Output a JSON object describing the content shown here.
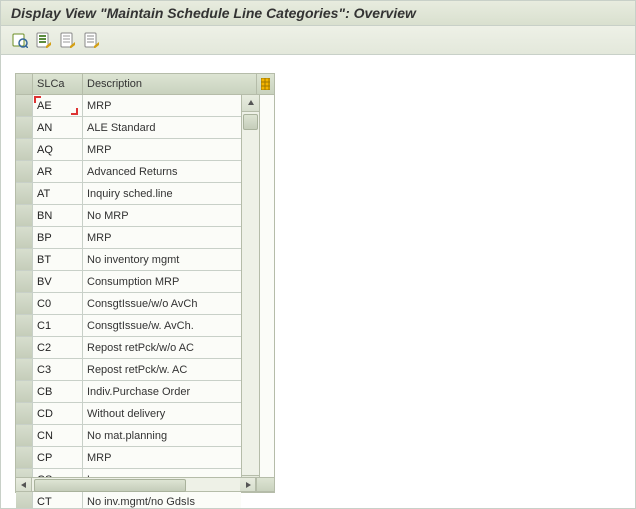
{
  "title": "Display View \"Maintain Schedule Line Categories\": Overview",
  "columns": {
    "slca": "SLCa",
    "desc": "Description"
  },
  "rows": [
    {
      "slca": "AE",
      "desc": "MRP"
    },
    {
      "slca": "AN",
      "desc": "ALE Standard"
    },
    {
      "slca": "AQ",
      "desc": "MRP"
    },
    {
      "slca": "AR",
      "desc": "Advanced Returns"
    },
    {
      "slca": "AT",
      "desc": "Inquiry sched.line"
    },
    {
      "slca": "BN",
      "desc": "No MRP"
    },
    {
      "slca": "BP",
      "desc": "MRP"
    },
    {
      "slca": "BT",
      "desc": "No inventory mgmt"
    },
    {
      "slca": "BV",
      "desc": "Consumption MRP"
    },
    {
      "slca": "C0",
      "desc": "ConsgtIssue/w/o AvCh"
    },
    {
      "slca": "C1",
      "desc": "ConsgtIssue/w. AvCh."
    },
    {
      "slca": "C2",
      "desc": "Repost retPck/w/o AC"
    },
    {
      "slca": "C3",
      "desc": "Repost retPck/w. AC"
    },
    {
      "slca": "CB",
      "desc": "Indiv.Purchase Order"
    },
    {
      "slca": "CD",
      "desc": "Without delivery"
    },
    {
      "slca": "CN",
      "desc": "No mat.planning"
    },
    {
      "slca": "CP",
      "desc": "MRP"
    },
    {
      "slca": "CS",
      "desc": "Leg"
    },
    {
      "slca": "CT",
      "desc": "No inv.mgmt/no GdsIs"
    }
  ]
}
